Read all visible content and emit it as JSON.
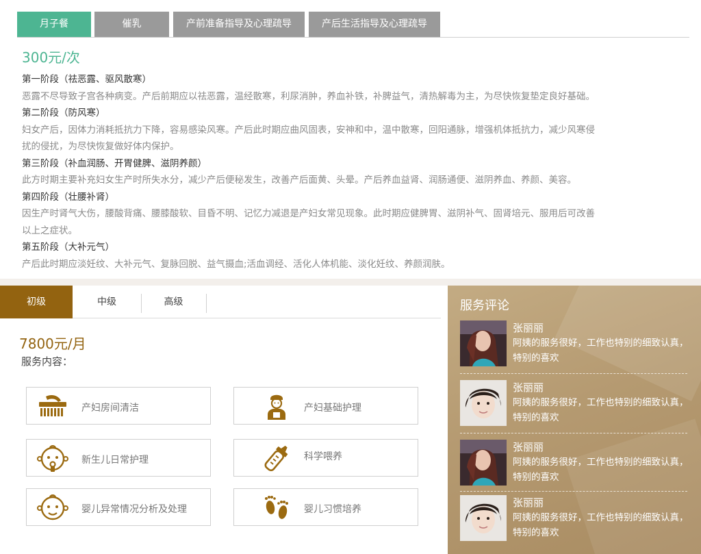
{
  "top_tabs": [
    "月子餐",
    "催乳",
    "产前准备指导及心理疏导",
    "产后生活指导及心理疏导"
  ],
  "top_price": "300元/次",
  "stages": [
    {
      "title": "第一阶段（祛恶露、驱风散寒）",
      "lines": [
        "恶露不尽导致子宫各种病变。产后前期应以祛恶露，温经散寒，利尿消肿，养血补铁，补脾益气，清热解毒为主，为尽快恢复垫定良好基础。"
      ]
    },
    {
      "title": "第二阶段（防风寒）",
      "lines": [
        "妇女产后，因体力消耗抵抗力下降，容易感染风寒。产后此时期应曲风固表，安神和中，温中散寒，回阳通脉，增强机体抵抗力，减少风寒侵",
        "扰的侵扰，为尽快恢复做好体内保护。"
      ]
    },
    {
      "title": "第三阶段（补血润肠、开胃健脾、滋阴养颜）",
      "lines": [
        "此方时期主要补充妇女生产时所失水分，减少产后便秘发生，改善产后面黄、头晕。产后养血益肾、润肠通便、滋阴养血、养颜、美容。"
      ]
    },
    {
      "title": "第四阶段（壮腰补肾）",
      "lines": [
        "因生产时肾气大伤，腰酸背痛、腰膝酸软、目昏不明、记忆力减退是产妇女常见现象。此时期应健脾胃、滋阴补气、固肾培元、服用后可改善",
        "以上之症状。"
      ]
    },
    {
      "title": "第五阶段（大补元气）",
      "lines": [
        "产后此时期应淡妊纹、大补元气、复脉回脱、益气摄血;活血调经、活化人体机能、淡化妊纹、养颜润肤。"
      ]
    }
  ],
  "level_tabs": [
    "初级",
    "中级",
    "高级"
  ],
  "level_price": "7800元/月",
  "service_label": "服务内容：",
  "services": [
    {
      "label": "产妇房间清洁",
      "icon": "brush-icon"
    },
    {
      "label": "产妇基础护理",
      "icon": "nurse-icon"
    },
    {
      "label": "新生儿日常护理",
      "icon": "baby-face-icon"
    },
    {
      "label": "科学喂养",
      "icon": "baby-bottle-icon"
    },
    {
      "label": "婴儿异常情况分析及处理",
      "icon": "baby-face-icon"
    },
    {
      "label": "婴儿习惯培养",
      "icon": "footprints-icon"
    }
  ],
  "reviews_title": "服务评论",
  "reviews": [
    {
      "name": "张丽丽",
      "text": "阿姨的服务很好，工作也特别的细致认真，特别的喜欢"
    },
    {
      "name": "张丽丽",
      "text": "阿姨的服务很好，工作也特别的细致认真，特别的喜欢"
    },
    {
      "name": "张丽丽",
      "text": "阿姨的服务很好，工作也特别的细致认真，特别的喜欢"
    },
    {
      "name": "张丽丽",
      "text": "阿姨的服务很好，工作也特别的细致认真，特别的喜欢"
    }
  ],
  "colors": {
    "green": "#4db592",
    "gray_tab": "#9a9a9a",
    "brown": "#936310",
    "review_bg": "#b59a71"
  }
}
